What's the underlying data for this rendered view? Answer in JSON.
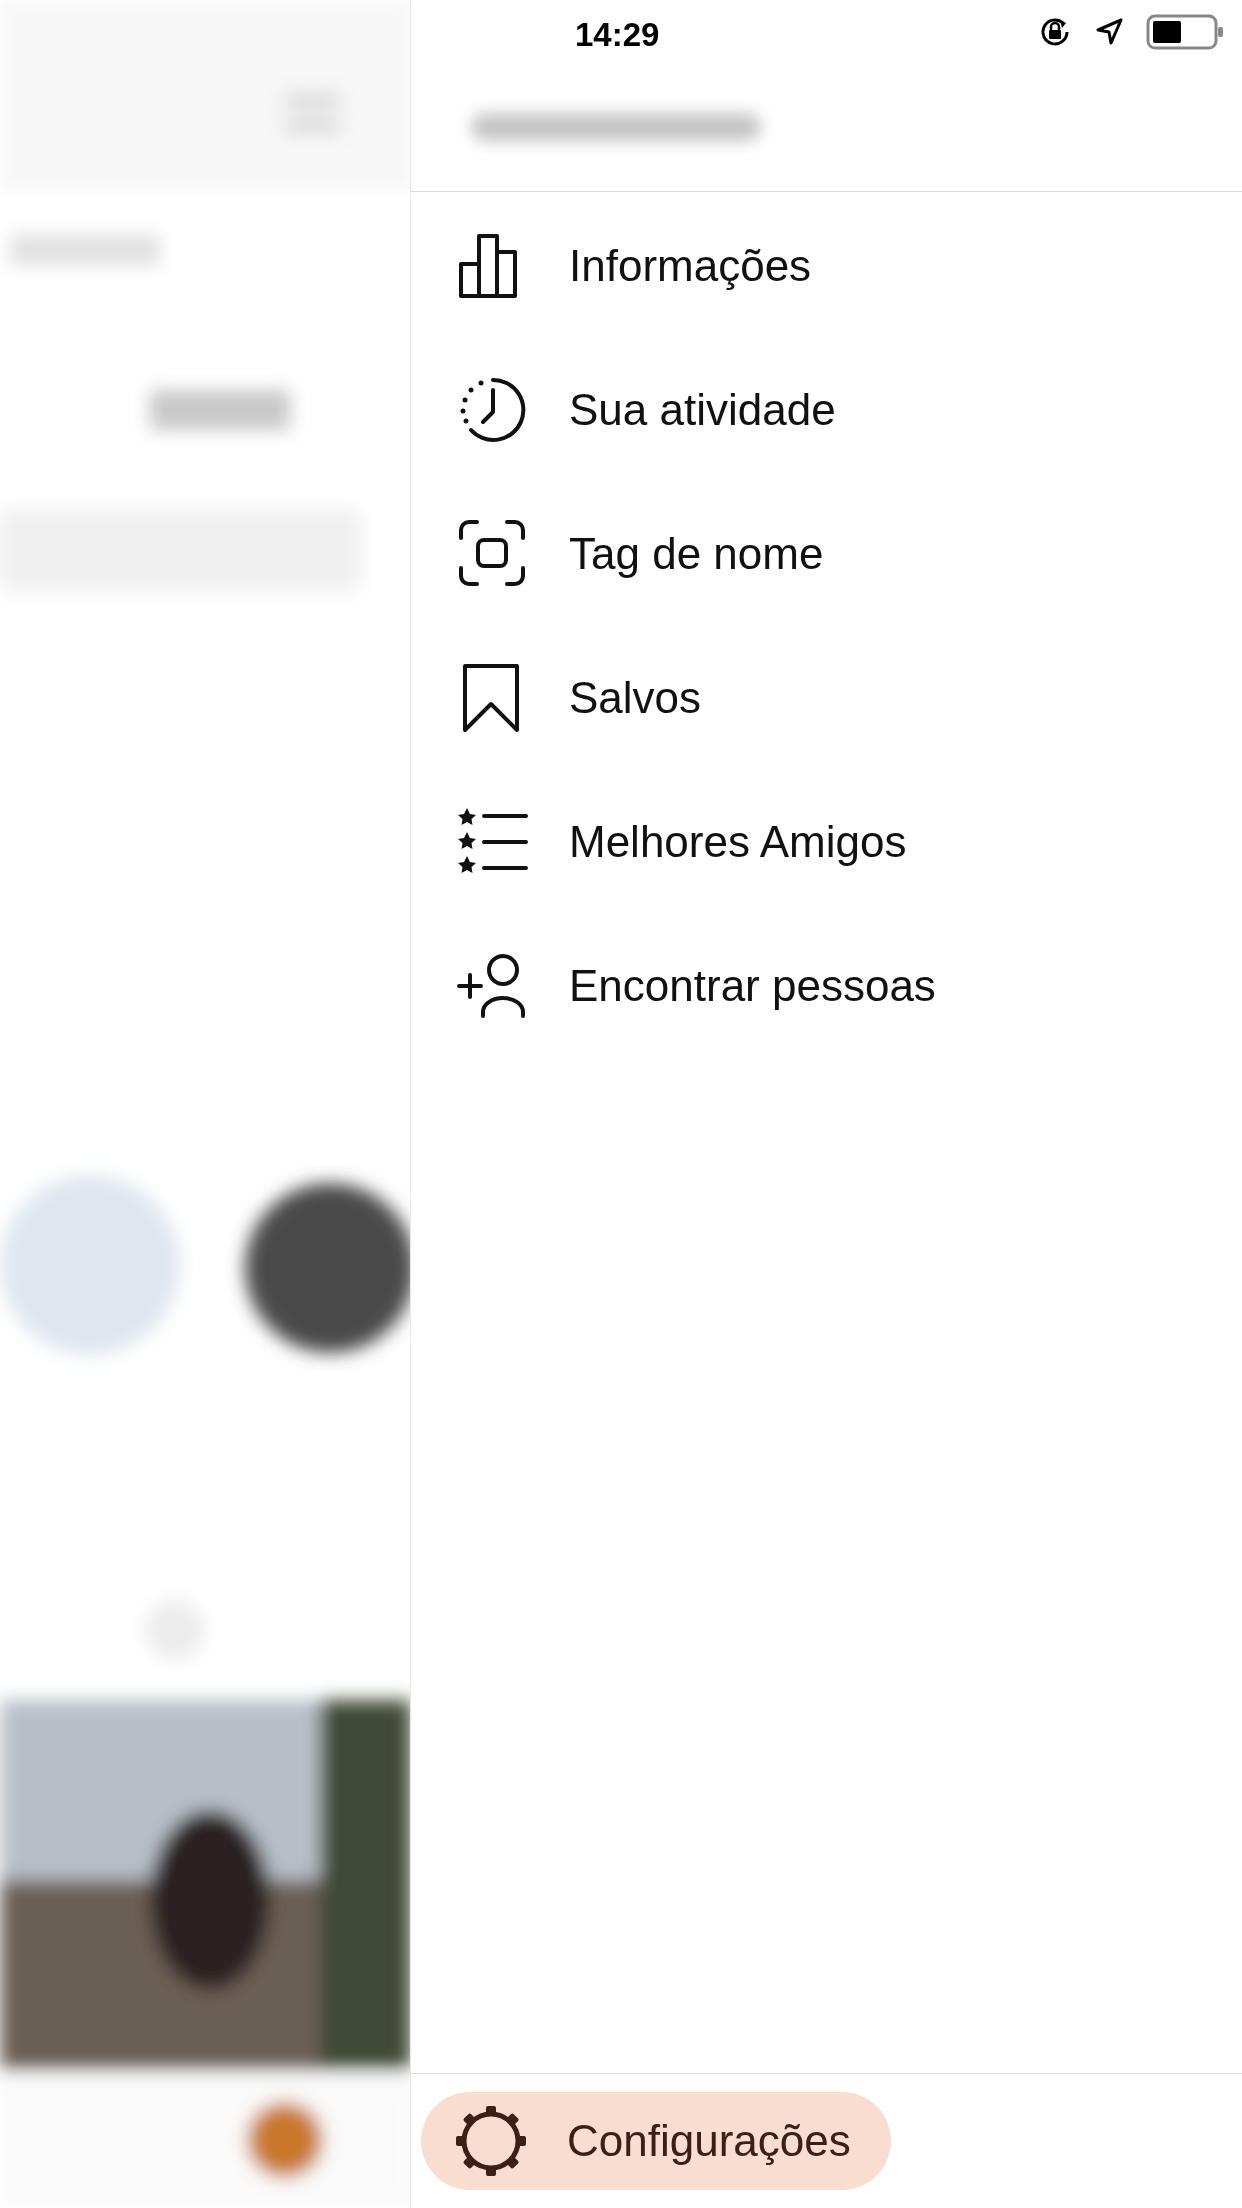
{
  "status_bar": {
    "time": "14:29"
  },
  "menu": {
    "items": [
      {
        "label": "Informações",
        "kind": "insights"
      },
      {
        "label": "Sua atividade",
        "kind": "activity"
      },
      {
        "label": "Tag de nome",
        "kind": "nametag"
      },
      {
        "label": "Salvos",
        "kind": "saved"
      },
      {
        "label": "Melhores Amigos",
        "kind": "close_friends"
      },
      {
        "label": "Encontrar pessoas",
        "kind": "discover"
      }
    ]
  },
  "footer": {
    "label": "Configurações",
    "highlighted": true
  }
}
